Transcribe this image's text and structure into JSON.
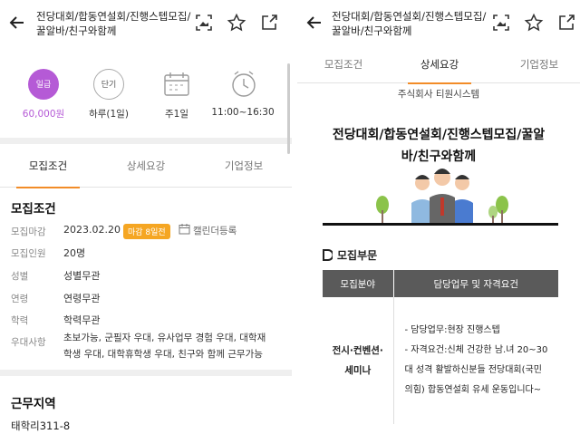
{
  "left": {
    "header": {
      "title_line1": "전당대회/합동연설회/진행스텝모집/",
      "title_line2": "꿀알바/친구와함께"
    },
    "summary": [
      {
        "icon": "wage-badge-icon",
        "badge": "일급",
        "value": "60,000원",
        "accent": "#b55ad6"
      },
      {
        "icon": "short-term-icon",
        "badge": "단기",
        "value": "하루(1일)"
      },
      {
        "icon": "calendar-icon",
        "value": "주1일"
      },
      {
        "icon": "clock-icon",
        "value": "11:00~16:30"
      }
    ],
    "tabs": [
      "모집조건",
      "상세요강",
      "기업정보"
    ],
    "recruit": {
      "title": "모집조건",
      "rows": [
        {
          "label": "모집마감",
          "value": "2023.02.20",
          "badge": "마감 8일전",
          "extra": "캘린더등록"
        },
        {
          "label": "모집인원",
          "value": "20명"
        },
        {
          "label": "성별",
          "value": "성별무관"
        },
        {
          "label": "연령",
          "value": "연령무관"
        },
        {
          "label": "학력",
          "value": "학력무관"
        },
        {
          "label": "우대사항",
          "value_line1": "초보가능, 군필자 우대, 유사업무 경험 우대, 대학재",
          "value_line2": "학생 우대, 대학휴학생 우대, 친구와 함께 근무가능"
        }
      ]
    },
    "work": {
      "title": "근무지역",
      "address": "태학리311-8"
    }
  },
  "right": {
    "header": {
      "title_line1": "전당대회/합동연설회/진행스텝모집/",
      "title_line2": "꿀알바/친구와함께"
    },
    "tabs": [
      "모집조건",
      "상세요강",
      "기업정보"
    ],
    "company": "주식회사 티원시스템",
    "poster_title_line1": "전당대회/합동연설회/진행스텝모집/꿀알",
    "poster_title_line2": "바/친구와함께",
    "section": "모집부문",
    "table": {
      "headers": [
        "모집분야",
        "담당업무 및 자격요건"
      ],
      "field_line1": "전시·컨벤션·",
      "field_line2": "세미나",
      "duties": [
        "- 담당업무:현장 진행스텝",
        "- 자격요건:신체 건강한 남.녀 20~30",
        "대 성격 활발하신분들 전당대회(국민",
        "의힘) 합동연설회 유세 운동입니다~"
      ]
    }
  },
  "colors": {
    "accent": "#f28c28",
    "badge": "#f5a623",
    "purple": "#b55ad6"
  }
}
